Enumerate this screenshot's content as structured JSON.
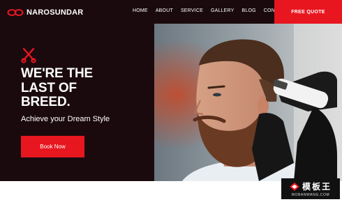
{
  "brand": {
    "name": "NAROSUNDAR",
    "accent": "#e8161f",
    "background": "#1a0a0e"
  },
  "nav": {
    "items": [
      "HOME",
      "ABOUT",
      "SERVICE",
      "GALLERY",
      "BLOG",
      "CONTACT"
    ]
  },
  "header": {
    "cta_label": "FREE QUOTE"
  },
  "hero": {
    "icon": "scissors-icon",
    "headline": [
      "WE'RE THE",
      "LAST OF",
      "BREED."
    ],
    "tagline": "Achieve your Dream Style",
    "button_label": "Book Now"
  },
  "watermark": {
    "main": "模板王",
    "sub": "MOBANWANG.COM"
  }
}
